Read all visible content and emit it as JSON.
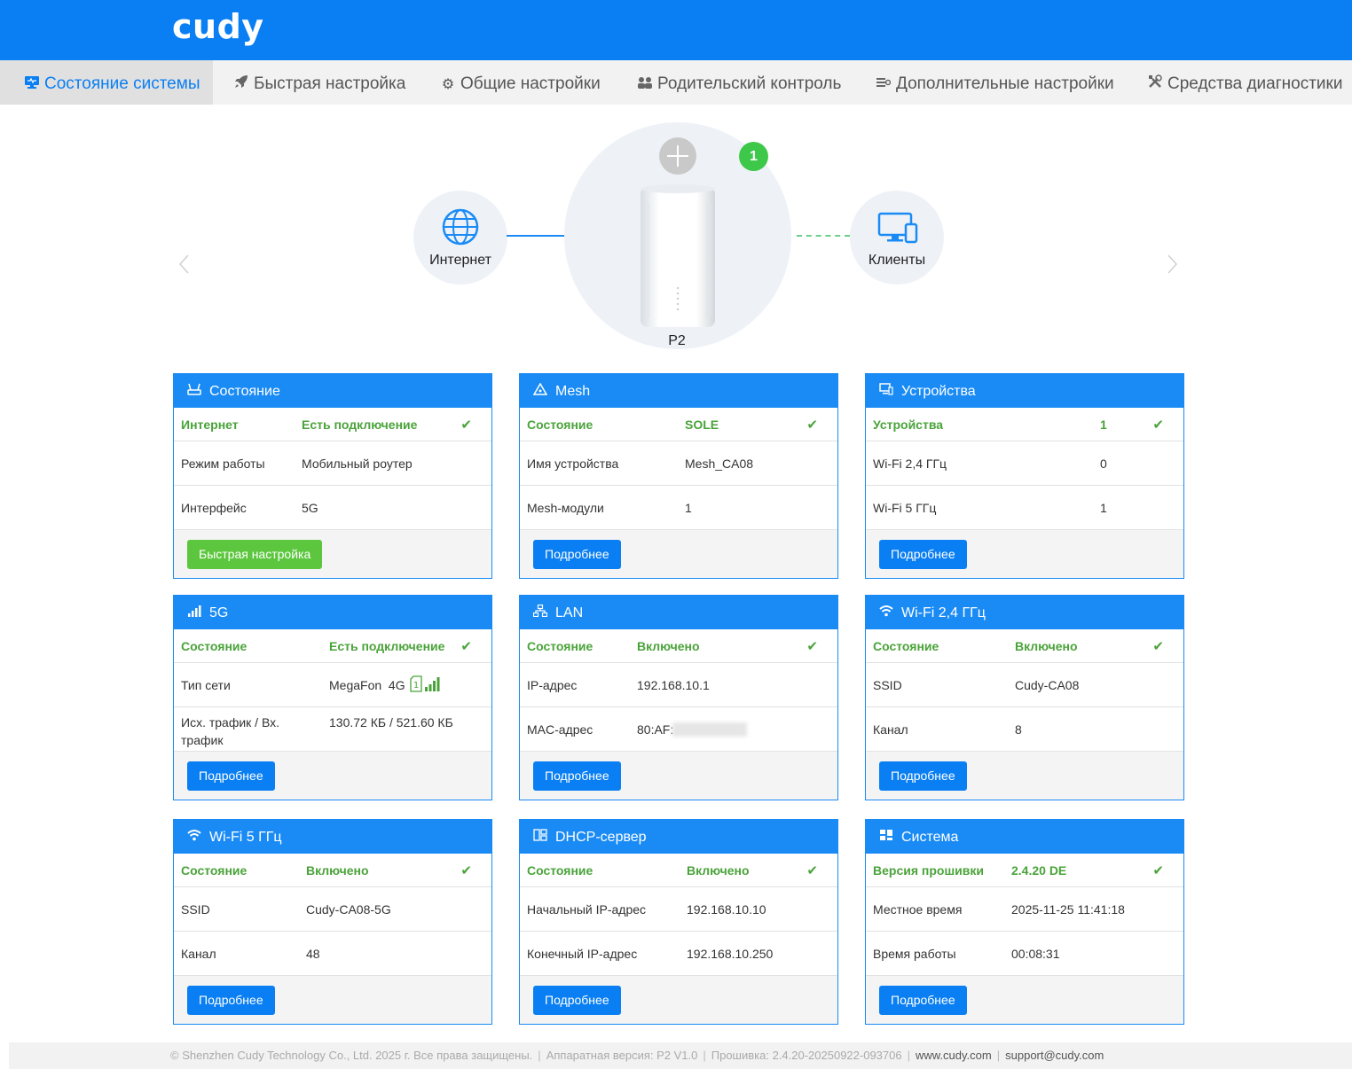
{
  "header": {
    "logo": "cudy"
  },
  "nav": [
    {
      "icon": "monitor-icon",
      "label": "Состояние системы",
      "active": true
    },
    {
      "icon": "rocket-icon",
      "label": "Быстрая настройка"
    },
    {
      "icon": "gear-icon",
      "label": "Общие настройки"
    },
    {
      "icon": "users-icon",
      "label": "Родительский контроль"
    },
    {
      "icon": "sliders-icon",
      "label": "Дополнительные настройки"
    },
    {
      "icon": "tools-icon",
      "label": "Средства диагностики"
    }
  ],
  "topology": {
    "internet_label": "Интернет",
    "clients_label": "Клиенты",
    "router_name": "P2",
    "mesh_count": "1"
  },
  "cards": {
    "status": {
      "title": "Состояние",
      "rows": [
        {
          "k": "Интернет",
          "v": "Есть подключение"
        },
        {
          "k": "Режим работы",
          "v": "Мобильный роутер"
        },
        {
          "k": "Интерфейс",
          "v": "5G"
        }
      ],
      "button": "Быстрая настройка"
    },
    "mesh": {
      "title": "Mesh",
      "rows": [
        {
          "k": "Состояние",
          "v": "SOLE"
        },
        {
          "k": "Имя устройства",
          "v": "Mesh_CA08"
        },
        {
          "k": "Mesh-модули",
          "v": "1"
        }
      ],
      "button": "Подробнее"
    },
    "devices": {
      "title": "Устройства",
      "rows": [
        {
          "k": "Устройства",
          "v": "1"
        },
        {
          "k": "Wi-Fi 2,4 ГГц",
          "v": "0"
        },
        {
          "k": "Wi-Fi 5 ГГц",
          "v": "1"
        }
      ],
      "button": "Подробнее"
    },
    "g5": {
      "title": "5G",
      "rows": [
        {
          "k": "Состояние",
          "v": "Есть подключение"
        },
        {
          "k": "Тип сети",
          "v": "MegaFon  4G"
        },
        {
          "k": "Исх. трафик / Вх. трафик",
          "v": "130.72 КБ / 521.60 КБ"
        }
      ],
      "sim_slot": "1",
      "button": "Подробнее"
    },
    "lan": {
      "title": "LAN",
      "rows": [
        {
          "k": "Состояние",
          "v": "Включено"
        },
        {
          "k": "IP-адрес",
          "v": "192.168.10.1"
        },
        {
          "k": "MAC-адрес",
          "v": "80:AF:"
        }
      ],
      "button": "Подробнее"
    },
    "wifi24": {
      "title": "Wi-Fi 2,4 ГГц",
      "rows": [
        {
          "k": "Состояние",
          "v": "Включено"
        },
        {
          "k": "SSID",
          "v": "Cudy-CA08"
        },
        {
          "k": "Канал",
          "v": "8"
        }
      ],
      "button": "Подробнее"
    },
    "wifi5": {
      "title": "Wi-Fi 5 ГГц",
      "rows": [
        {
          "k": "Состояние",
          "v": "Включено"
        },
        {
          "k": "SSID",
          "v": "Cudy-CA08-5G"
        },
        {
          "k": "Канал",
          "v": "48"
        }
      ],
      "button": "Подробнее"
    },
    "dhcp": {
      "title": "DHCP-сервер",
      "rows": [
        {
          "k": "Состояние",
          "v": "Включено"
        },
        {
          "k": "Начальный IP-адрес",
          "v": "192.168.10.10"
        },
        {
          "k": "Конечный IP-адрес",
          "v": "192.168.10.250"
        }
      ],
      "button": "Подробнее"
    },
    "system": {
      "title": "Система",
      "rows": [
        {
          "k": "Версия прошивки",
          "v": "2.4.20 DE"
        },
        {
          "k": "Местное время",
          "v": "2025-11-25 11:41:18"
        },
        {
          "k": "Время работы",
          "v": "00:08:31"
        }
      ],
      "button": "Подробнее"
    }
  },
  "footer": {
    "copyright": "© Shenzhen Cudy Technology Co., Ltd. 2025 г. Все права защищены.",
    "hardware": "Аппаратная версия: P2 V1.0",
    "firmware": "Прошивка: 2.4.20-20250922-093706",
    "site": "www.cudy.com",
    "email": "support@cudy.com"
  },
  "colors": {
    "brand": "#0a7ff3",
    "ok": "#4aa33a",
    "green_button": "#5cc73e",
    "mesh_badge": "#3ec84a"
  }
}
